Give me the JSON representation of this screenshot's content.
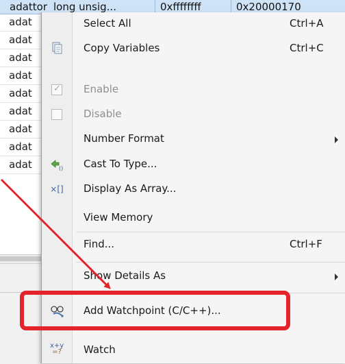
{
  "table": {
    "header": {
      "name": "adattor",
      "type": "long unsig...",
      "value": "0xffffffff",
      "address": "0x20000170"
    },
    "rows": [
      "adat",
      "adat",
      "adat",
      "adat",
      "adat",
      "adat",
      "adat",
      "adat",
      "adat"
    ]
  },
  "menu": {
    "items": [
      {
        "label": "Select All",
        "shortcut": "Ctrl+A"
      },
      {
        "label": "Copy Variables",
        "shortcut": "Ctrl+C",
        "icon": "copy-icon"
      },
      {
        "label": "Enable",
        "icon": "checkbox-checked-icon",
        "disabled": true
      },
      {
        "label": "Disable",
        "icon": "checkbox-icon",
        "disabled": true
      },
      {
        "label": "Number Format",
        "submenu": true
      },
      {
        "label": "Cast To Type...",
        "icon": "cast-type-icon"
      },
      {
        "label": "Display As Array...",
        "icon": "array-icon"
      },
      {
        "label": "View Memory"
      },
      {
        "label": "Find...",
        "shortcut": "Ctrl+F"
      },
      {
        "label": "Show Details As",
        "submenu": true
      },
      {
        "label": "Add Watchpoint (C/C++)...",
        "icon": "watchpoint-glasses-icon"
      },
      {
        "label": "Watch",
        "icon": "watch-expression-icon"
      }
    ]
  },
  "icons": {
    "array": "×[]",
    "watch_top": "x+y",
    "watch_bottom": "=?"
  },
  "colors": {
    "highlight": "#e3242b",
    "header_bg": "#cfe3f6"
  }
}
